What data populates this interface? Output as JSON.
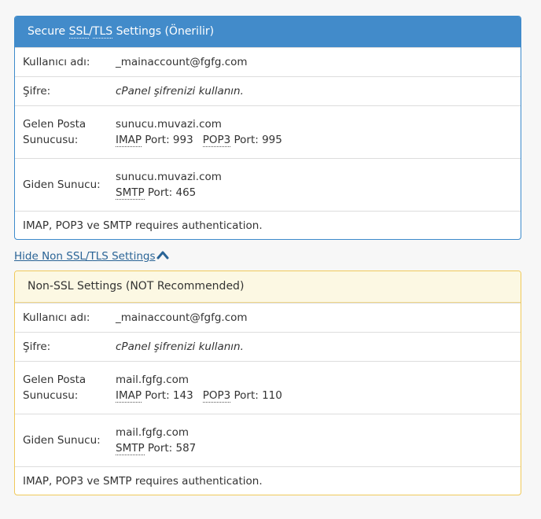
{
  "ssl": {
    "heading_prefix": "Secure ",
    "heading_ssl": "SSL",
    "heading_sep": "/",
    "heading_tls": "TLS",
    "heading_suffix": " Settings (Önerilir)",
    "username_label": "Kullanıcı adı:",
    "username_value": "_mainaccount@fgfg.com",
    "password_label": "Şifre:",
    "password_value": "cPanel şifrenizi kullanın.",
    "incoming_label_1": "Gelen Posta",
    "incoming_label_2": "Sunucusu:",
    "incoming_host": "sunucu.muvazi.com",
    "imap_abbr": "IMAP",
    "imap_port_text": " Port: 993",
    "pop3_abbr": "POP3",
    "pop3_port_text": " Port: 995",
    "outgoing_label": "Giden Sunucu:",
    "outgoing_host": "sunucu.muvazi.com",
    "smtp_abbr": "SMTP",
    "smtp_port_text": " Port: 465",
    "auth_note": "IMAP, POP3 ve SMTP requires authentication."
  },
  "toggle": {
    "label": "Hide Non SSL/TLS Settings",
    "icon": "chevron-up-icon"
  },
  "nonssl": {
    "heading": "Non-SSL Settings (NOT Recommended)",
    "username_label": "Kullanıcı adı:",
    "username_value": "_mainaccount@fgfg.com",
    "password_label": "Şifre:",
    "password_value": "cPanel şifrenizi kullanın.",
    "incoming_label_1": "Gelen Posta",
    "incoming_label_2": "Sunucusu:",
    "incoming_host": "mail.fgfg.com",
    "imap_abbr": "IMAP",
    "imap_port_text": " Port: 143",
    "pop3_abbr": "POP3",
    "pop3_port_text": " Port: 110",
    "outgoing_label": "Giden Sunucu:",
    "outgoing_host": "mail.fgfg.com",
    "smtp_abbr": "SMTP",
    "smtp_port_text": " Port: 587",
    "auth_note": "IMAP, POP3 ve SMTP requires authentication."
  },
  "colors": {
    "ssl_heading_bg": "#428bca",
    "nonssl_heading_bg": "#fcf8e3",
    "link": "#2a6496"
  }
}
